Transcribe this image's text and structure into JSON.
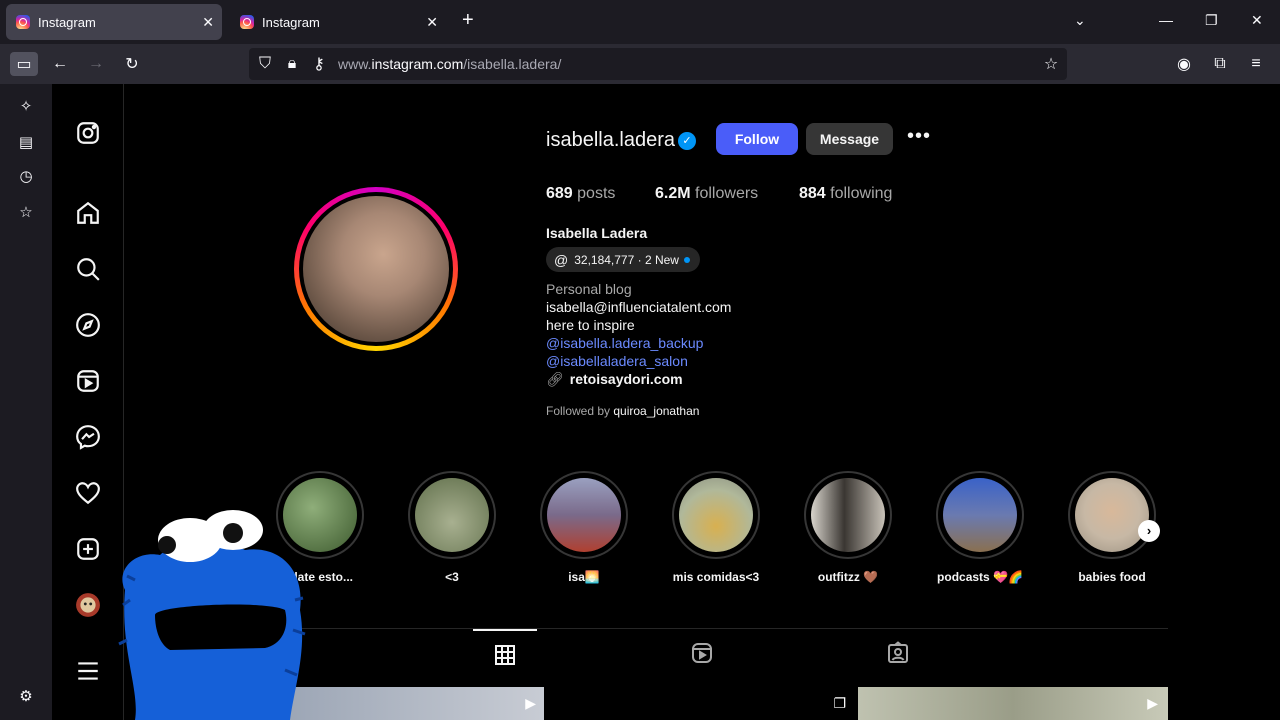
{
  "browser": {
    "tabs": [
      {
        "title": "Instagram",
        "active": true
      },
      {
        "title": "Instagram",
        "active": false
      }
    ],
    "new_tab_label": "+",
    "url_prefix": "www.",
    "url_domain": "instagram.com",
    "url_path": "/isabella.ladera/"
  },
  "profile": {
    "username": "isabella.ladera",
    "verified": true,
    "follow_label": "Follow",
    "message_label": "Message",
    "more_label": "•••",
    "posts_count": "689",
    "posts_label": "posts",
    "followers_count": "6.2M",
    "followers_label": "followers",
    "following_count": "884",
    "following_label": "following",
    "full_name": "Isabella Ladera",
    "threads_badge": "32,184,777 · 2 New",
    "bio_category": "Personal blog",
    "bio_lines": [
      "isabella@influenciatalent.com",
      "here to inspire"
    ],
    "bio_mentions": [
      "@isabella.ladera_backup",
      "@isabellaladera_salon"
    ],
    "external_link": "retoisaydori.com",
    "followed_by_prefix": "Followed by ",
    "followed_by_user": "quiroa_jonathan"
  },
  "highlights": [
    {
      "label": "plate esto...",
      "color": "#5f7a4e"
    },
    {
      "label": "<3",
      "color": "#7d8a6a"
    },
    {
      "label": "isa🌅",
      "color": "#8a7d8f"
    },
    {
      "label": "mis comidas<3",
      "color": "#9aa08a"
    },
    {
      "label": "outfitzz 🤎",
      "color": "#6e6964"
    },
    {
      "label": "podcasts 💝🌈",
      "color": "#4a5a88"
    },
    {
      "label": "babies food",
      "color": "#c7b8a5"
    }
  ],
  "colors": {
    "follow_button": "#4a5df9",
    "link": "#6b8aff",
    "verified_badge": "#0095f6"
  }
}
